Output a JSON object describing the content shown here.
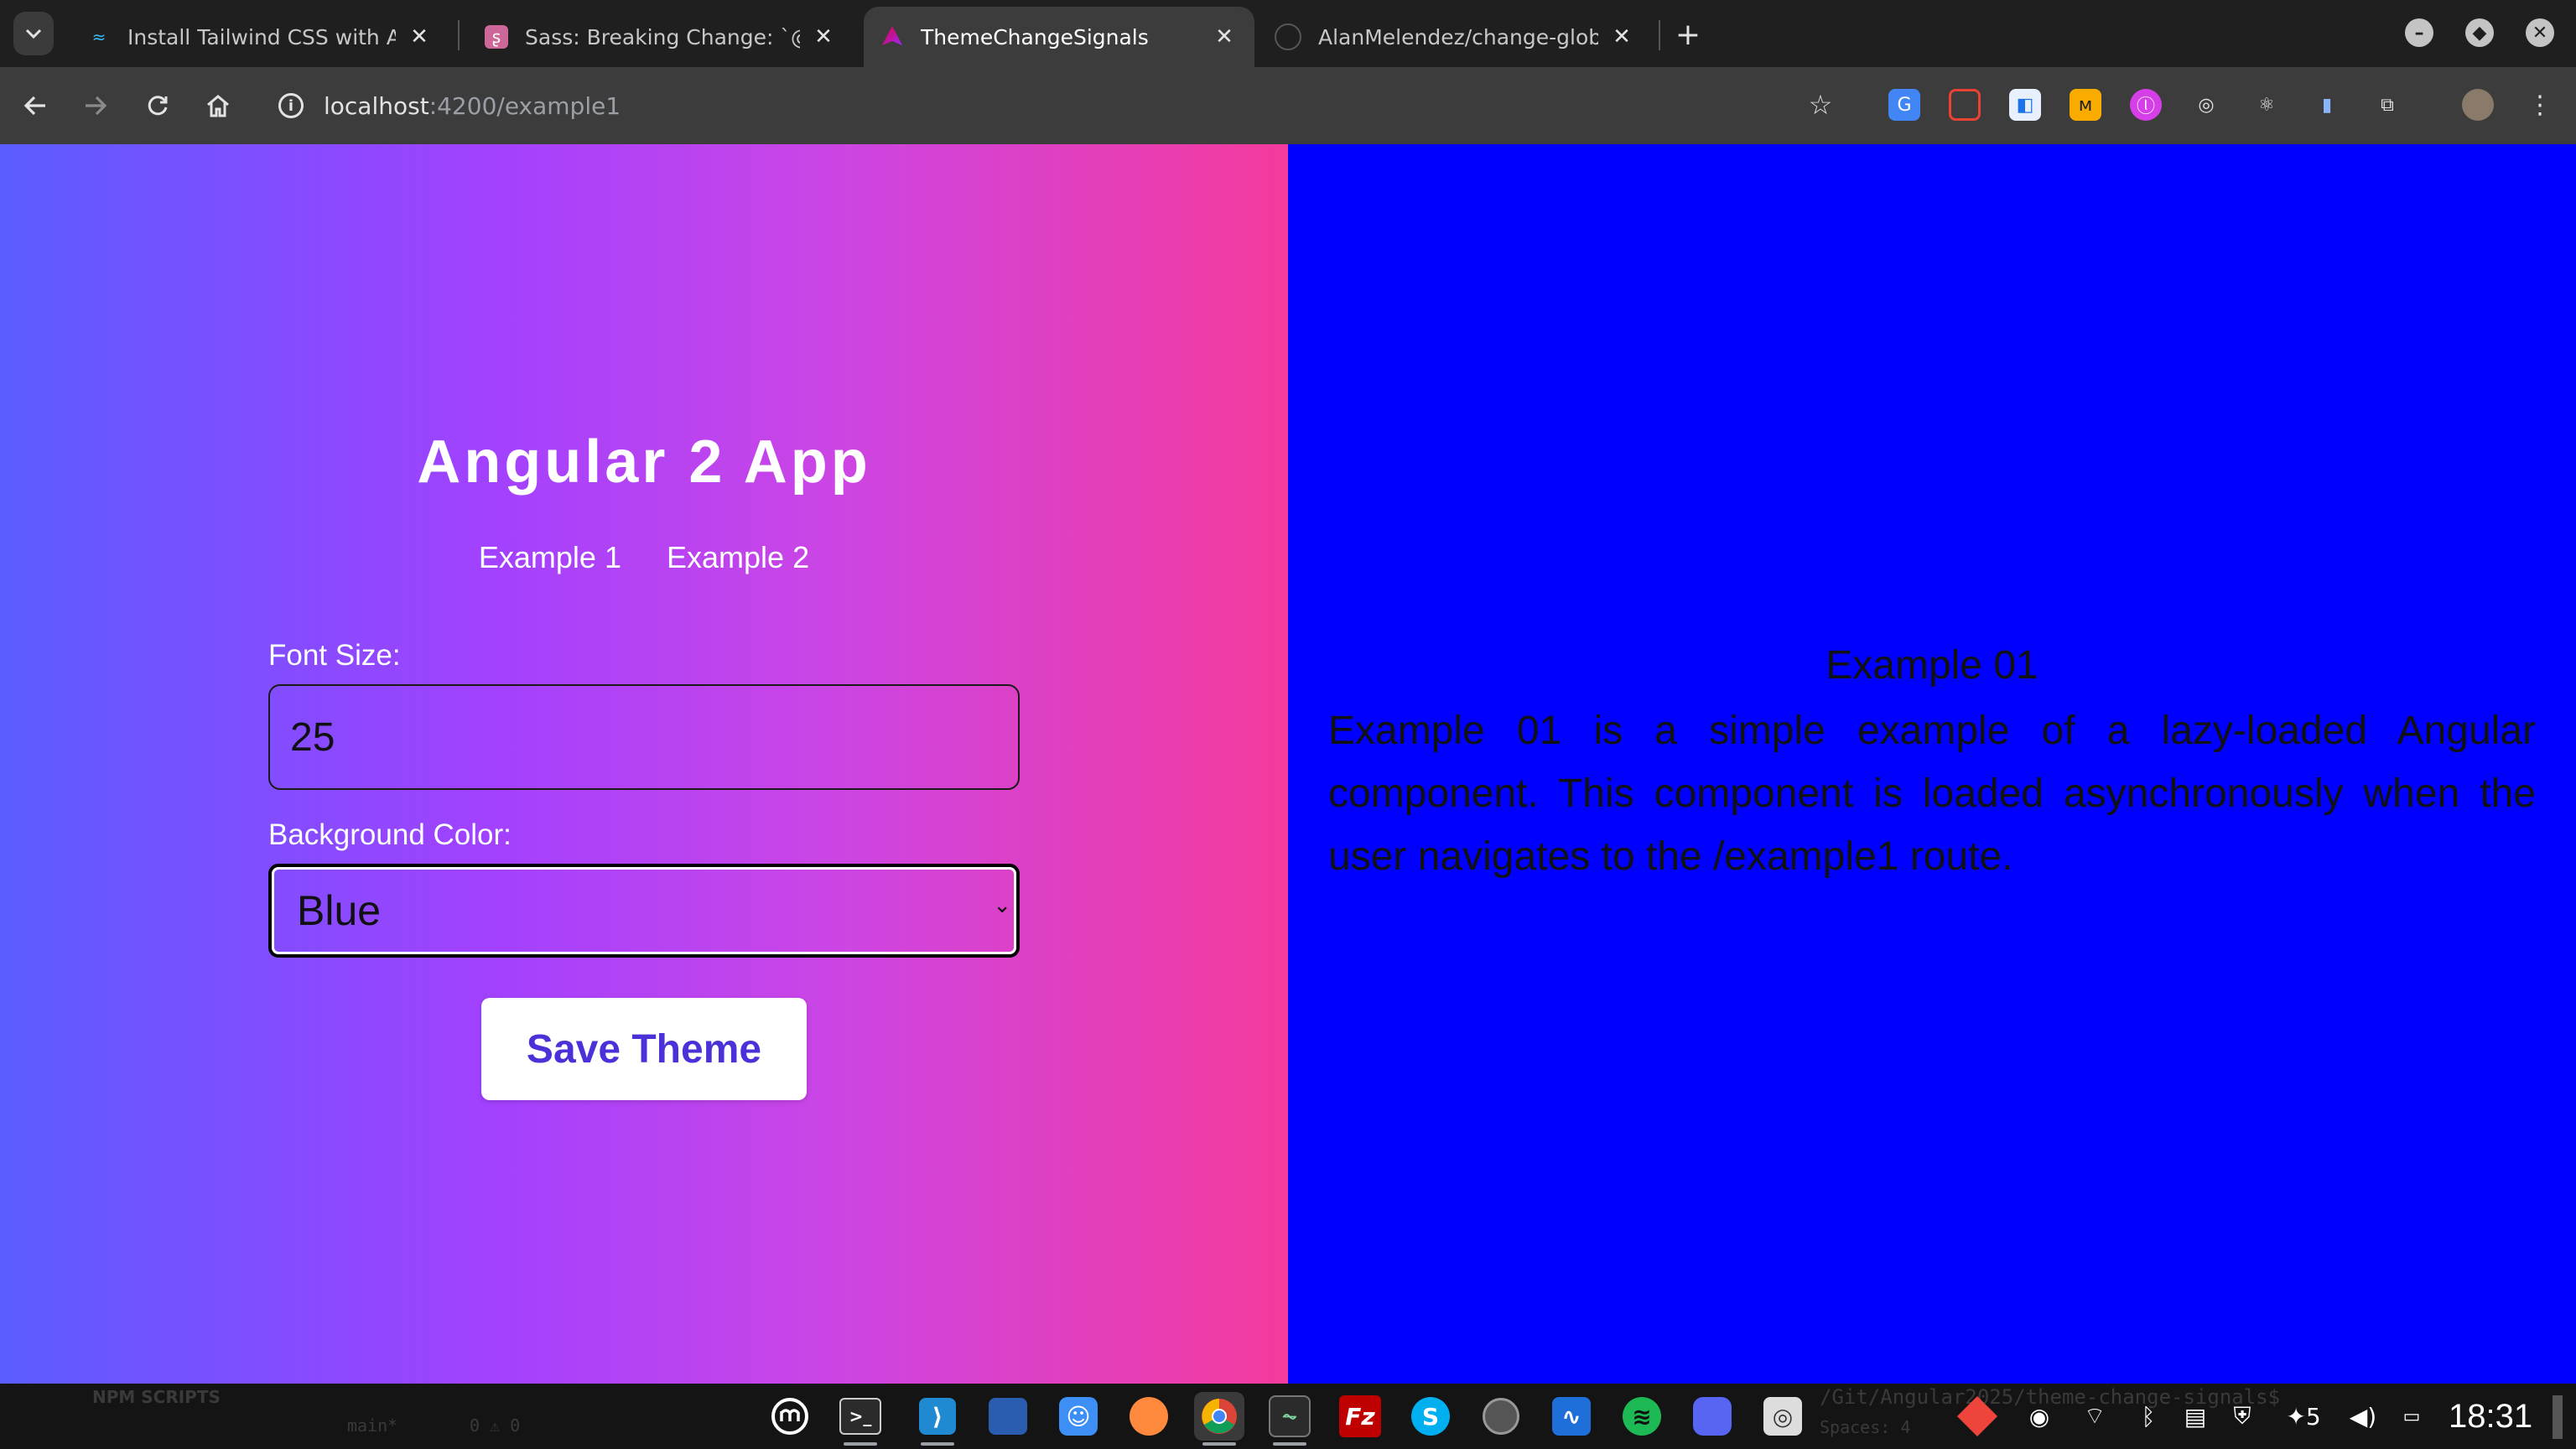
{
  "browser": {
    "tabs": [
      {
        "title": "Install Tailwind CSS with Ang",
        "active": false
      },
      {
        "title": "Sass: Breaking Change: `@im",
        "active": false
      },
      {
        "title": "ThemeChangeSignals",
        "active": true
      },
      {
        "title": "AlanMelendez/change-globa",
        "active": false
      }
    ],
    "close_glyph": "✕",
    "new_tab_glyph": "+",
    "url_host": "localhost",
    "url_rest": ":4200/example1"
  },
  "app": {
    "title": "Angular 2 App",
    "nav": [
      "Example 1",
      "Example 2"
    ],
    "font_size_label": "Font Size:",
    "font_size_value": "25",
    "background_color_label": "Background Color:",
    "background_color_value": "Blue",
    "save_button": "Save Theme",
    "left_gradient": [
      "#5a5cff",
      "#a241ff",
      "#cc45e4",
      "#f43a9c"
    ],
    "panel_background": "#0000ff"
  },
  "example": {
    "title": "Example 01",
    "body": "Example 01 is a simple example of a lazy-loaded Angular component. This component is loaded asynchronously when the user navigates to the /example1 route."
  },
  "taskbar": {
    "background_text": {
      "npm_scripts": "NPM SCRIPTS",
      "branch": "main*",
      "errors": "0 ⚠ 0",
      "terminal_path": "/Git/Angular2025/theme-change-signals$",
      "spaces": "Spaces: 4"
    },
    "apps": [
      "menu-icon",
      "terminal-icon",
      "vscode-icon",
      "files-icon",
      "finder-icon",
      "firefox-icon",
      "chrome-icon",
      "system-monitor-icon",
      "filezilla-icon",
      "skype-icon",
      "disks-icon",
      "activity-icon",
      "spotify-icon",
      "discord-icon",
      "screenshot-icon"
    ],
    "notifications_count": "5",
    "clock": "18:31"
  }
}
